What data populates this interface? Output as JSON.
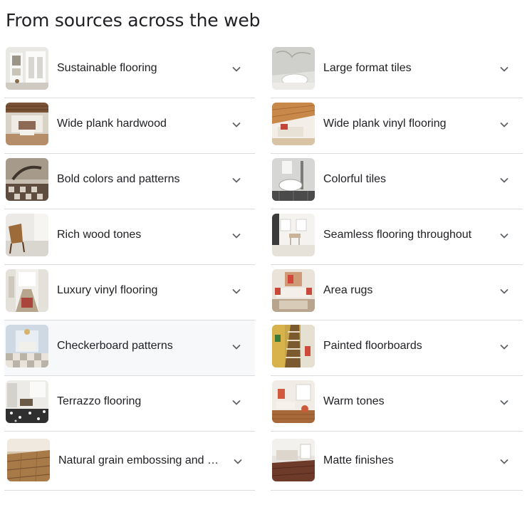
{
  "heading": "From sources across the web",
  "left_items": [
    {
      "label": "Sustainable flooring",
      "icon": "chevron-down-icon"
    },
    {
      "label": "Wide plank hardwood",
      "icon": "chevron-down-icon"
    },
    {
      "label": "Bold colors and patterns",
      "icon": "chevron-down-icon"
    },
    {
      "label": "Rich wood tones",
      "icon": "chevron-down-icon"
    },
    {
      "label": "Luxury vinyl flooring",
      "icon": "chevron-down-icon"
    },
    {
      "label": "Checkerboard patterns",
      "icon": "chevron-down-icon"
    },
    {
      "label": "Terrazzo flooring",
      "icon": "chevron-down-icon"
    },
    {
      "label": "Natural grain embossing and …",
      "icon": "chevron-down-icon"
    }
  ],
  "right_items": [
    {
      "label": "Large format tiles",
      "icon": "chevron-down-icon"
    },
    {
      "label": "Wide plank vinyl flooring",
      "icon": "chevron-down-icon"
    },
    {
      "label": "Colorful tiles",
      "icon": "chevron-down-icon"
    },
    {
      "label": "Seamless flooring throughout",
      "icon": "chevron-down-icon"
    },
    {
      "label": "Area rugs",
      "icon": "chevron-down-icon"
    },
    {
      "label": "Painted floorboards",
      "icon": "chevron-down-icon"
    },
    {
      "label": "Warm tones",
      "icon": "chevron-down-icon"
    },
    {
      "label": "Matte finishes",
      "icon": "chevron-down-icon"
    }
  ],
  "colors": {
    "text": "#202124",
    "divider": "#dadce0",
    "hover_row": "#f6f8fa",
    "chevron": "#5f6368"
  }
}
